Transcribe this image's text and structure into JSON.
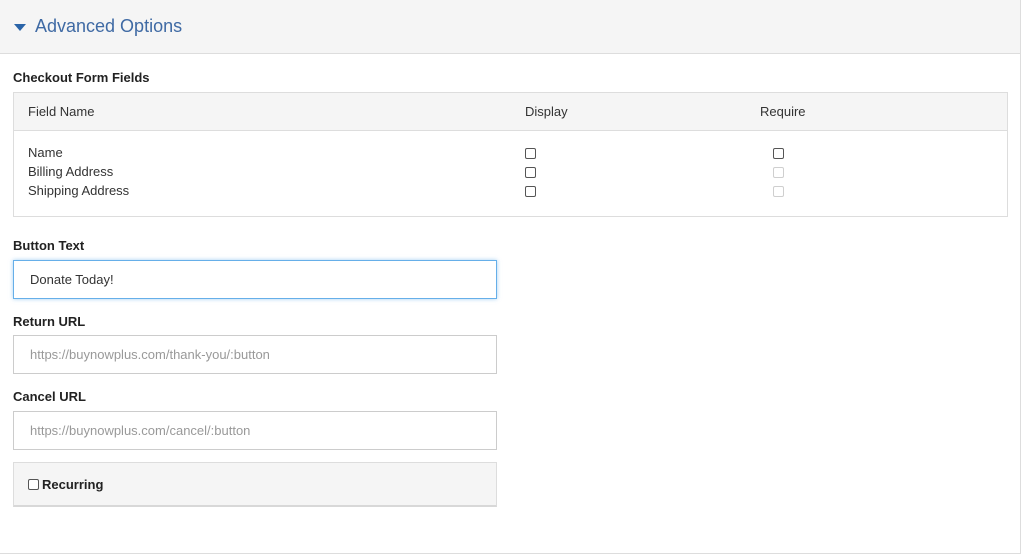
{
  "header": {
    "title": "Advanced Options",
    "icon": "caret-down-icon",
    "accent": "#3f6aa4"
  },
  "checkout_fields": {
    "section_label": "Checkout Form Fields",
    "columns": [
      "Field Name",
      "Display",
      "Require"
    ],
    "rows": [
      {
        "name": "Name",
        "display_checked": false,
        "require_checked": false,
        "require_enabled": true
      },
      {
        "name": "Billing Address",
        "display_checked": false,
        "require_checked": false,
        "require_enabled": false
      },
      {
        "name": "Shipping Address",
        "display_checked": false,
        "require_checked": false,
        "require_enabled": false
      }
    ]
  },
  "button_text": {
    "label": "Button Text",
    "value": "Donate Today!"
  },
  "return_url": {
    "label": "Return URL",
    "placeholder": "https://buynowplus.com/thank-you/:button"
  },
  "cancel_url": {
    "label": "Cancel URL",
    "placeholder": "https://buynowplus.com/cancel/:button"
  },
  "recurring": {
    "label": "Recurring",
    "checked": false
  }
}
